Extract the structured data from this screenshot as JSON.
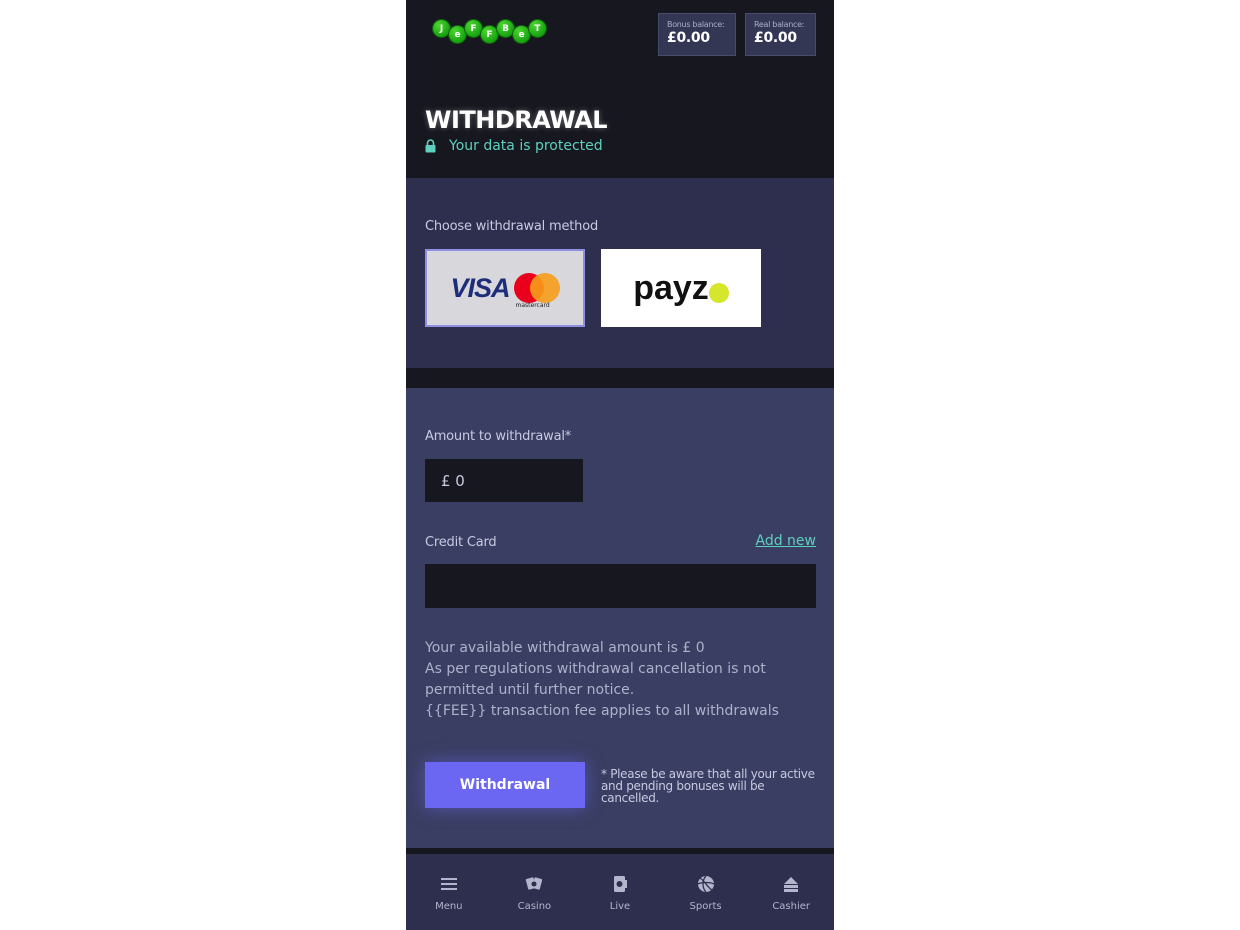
{
  "header": {
    "logo_letters": [
      "J",
      "e",
      "F",
      "F",
      "B",
      "e",
      "T"
    ],
    "bonus_balance": {
      "label": "Bonus balance:",
      "value": "£0.00"
    },
    "real_balance": {
      "label": "Real balance:",
      "value": "£0.00"
    },
    "title": "WITHDRAWAL",
    "protected_text": "Your data is protected"
  },
  "methods": {
    "label": "Choose withdrawal method",
    "items": [
      {
        "name": "VISA",
        "sub": "mastercard",
        "selected": true
      },
      {
        "name": "payz",
        "selected": false
      }
    ]
  },
  "form": {
    "amount_label": "Amount to withdrawal*",
    "amount_value": "£ 0",
    "card_label": "Credit Card",
    "add_new": "Add new",
    "card_value": "",
    "info_lines": [
      "Your available withdrawal amount is £ 0",
      "As per regulations withdrawal cancellation is not",
      "permitted until further notice.",
      "{{FEE}} transaction fee applies to all withdrawals"
    ],
    "withdraw_button": "Withdrawal",
    "note": "* Please be aware that all your active and pending bonuses will be cancelled."
  },
  "nav": {
    "items": [
      {
        "label": "Menu",
        "icon": "menu-icon"
      },
      {
        "label": "Casino",
        "icon": "casino-icon"
      },
      {
        "label": "Live",
        "icon": "live-icon"
      },
      {
        "label": "Sports",
        "icon": "sports-icon"
      },
      {
        "label": "Cashier",
        "icon": "cashier-icon"
      }
    ]
  },
  "colors": {
    "accent": "#6c67f2",
    "teal": "#5fd0be",
    "background_dark": "#16171f",
    "panel": "#2e2f4f",
    "form_panel": "#3a3e62"
  }
}
